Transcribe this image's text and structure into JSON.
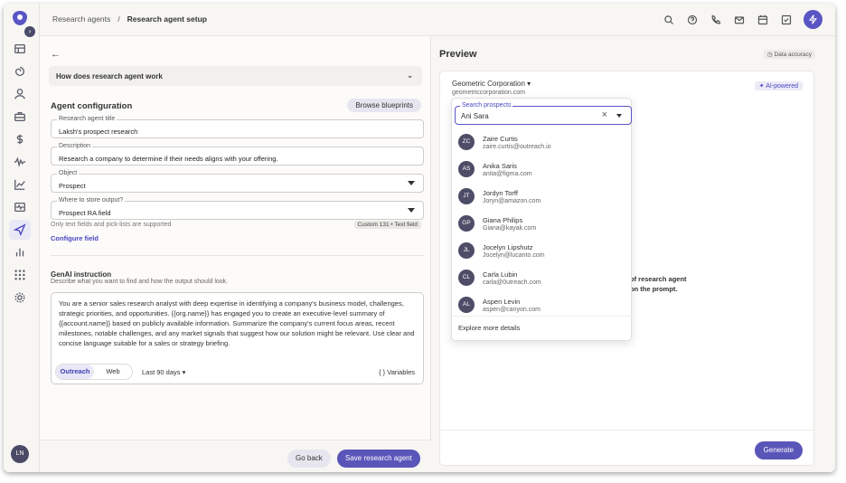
{
  "breadcrumb": {
    "parent": "Research agents",
    "sep": "/",
    "current": "Research agent setup"
  },
  "sidebar": {
    "collapse_glyph": "›",
    "avatar": "LN",
    "items": [
      "table-icon",
      "spiral-icon",
      "person-icon",
      "briefcase-icon",
      "dollar-icon",
      "waveform-icon",
      "trend-icon",
      "pulse-icon",
      "send-icon",
      "bar-chart-icon",
      "grid-icon",
      "settings-icon"
    ],
    "active": "send-icon"
  },
  "topbar": {
    "icons": [
      "search-icon",
      "help-icon",
      "phone-icon",
      "mail-icon",
      "calendar-icon",
      "task-icon",
      "bolt-icon"
    ]
  },
  "left": {
    "back_glyph": "←",
    "how": "How does research agent work",
    "config_title": "Agent configuration",
    "browse": "Browse blueprints",
    "fields": {
      "title": {
        "label": "Research agent title",
        "value": "Laksh's prospect research"
      },
      "description": {
        "label": "Description",
        "value": "Research a company to determine if their needs aligns with your offering."
      },
      "object": {
        "label": "Object",
        "value": "Prospect"
      },
      "store": {
        "label": "Where to store output?",
        "value": "Prospect RA field"
      }
    },
    "hint": "Only text fields and pick-lists are supported",
    "tag": "Custom 131 • Text field",
    "configure": "Configure field",
    "genai_title": "GenAI instruction",
    "genai_sub": "Describe what you want to find and how the output should look.",
    "instruction": "You are a senior sales research analyst with deep expertise in identifying a company's business model, challenges, strategic priorities, and opportunities. {{org.name}} has engaged you to create an executive-level summary of {{account.name}} based on publicly available information. Summarize the company's current focus areas, recent milestones, notable challenges, and any market signals that suggest how our solution might be relevant. Use clear and concise language suitable for a sales or strategy briefing.",
    "seg": {
      "outreach": "Outreach",
      "web": "Web"
    },
    "days": "Last 90 days",
    "vars": "Variables",
    "vars_glyph": "{ }",
    "go_back": "Go back",
    "save": "Save research agent"
  },
  "preview": {
    "title": "Preview",
    "accuracy": "Data accuracy",
    "company": "Geometric Corporation",
    "company_url": "geometriccorporation.com",
    "ai": "AI-powered",
    "bg_line1": "of research agent",
    "bg_line2": "on the prompt.",
    "generate": "Generate"
  },
  "dropdown": {
    "label": "Search prospects",
    "value": "Ani Sara",
    "people": [
      {
        "initials": "ZC",
        "name": "Zaire Curtis",
        "email": "zaire.curtis@outreach.io"
      },
      {
        "initials": "AS",
        "name": "Anika Saris",
        "email": "anita@figma.com"
      },
      {
        "initials": "JT",
        "name": "Jordyn Torff",
        "email": "Joryn@amazon.com"
      },
      {
        "initials": "GP",
        "name": "Giana Philips",
        "email": "Giana@kayak.com"
      },
      {
        "initials": "JL",
        "name": "Jocelyn Lipshutz",
        "email": "Jocelyn@lucanto.com"
      },
      {
        "initials": "CL",
        "name": "Carla Lubin",
        "email": "carla@0utreach.com"
      },
      {
        "initials": "AL",
        "name": "Aspen Levin",
        "email": "aspen@canyon.com"
      }
    ],
    "more": "Explore more details"
  }
}
